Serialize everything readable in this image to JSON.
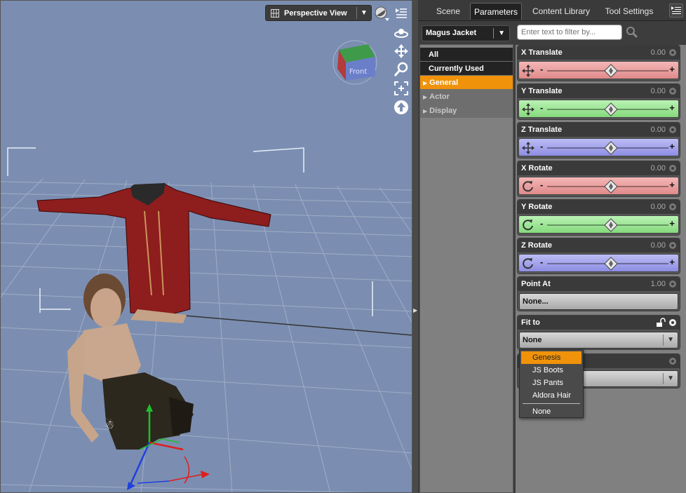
{
  "viewport": {
    "view_label": "Perspective View",
    "cube_face": "Front"
  },
  "tabs": [
    {
      "label": "Scene"
    },
    {
      "label": "Parameters"
    },
    {
      "label": "Content Library"
    },
    {
      "label": "Tool Settings"
    }
  ],
  "node_selector": {
    "value": "Magus Jacket"
  },
  "categories": [
    {
      "label": "All"
    },
    {
      "label": "Currently Used"
    },
    {
      "label": "General"
    },
    {
      "label": "Actor"
    },
    {
      "label": "Display"
    }
  ],
  "filter": {
    "placeholder": "Enter text to filter by..."
  },
  "properties": [
    {
      "label": "X Translate",
      "value": "0.00",
      "color": "red",
      "icon": "move-icon"
    },
    {
      "label": "Y Translate",
      "value": "0.00",
      "color": "green",
      "icon": "move-icon"
    },
    {
      "label": "Z Translate",
      "value": "0.00",
      "color": "blue",
      "icon": "move-icon"
    },
    {
      "label": "X Rotate",
      "value": "0.00",
      "color": "red",
      "icon": "rotate-icon"
    },
    {
      "label": "Y Rotate",
      "value": "0.00",
      "color": "green",
      "icon": "rotate-icon"
    },
    {
      "label": "Z Rotate",
      "value": "0.00",
      "color": "blue",
      "icon": "rotate-icon"
    }
  ],
  "slider_minus": "-",
  "slider_plus": "+",
  "point_at": {
    "label": "Point At",
    "value": "1.00",
    "button": "None..."
  },
  "fit_to": {
    "label": "Fit to",
    "value": "None"
  },
  "popup": {
    "items": [
      {
        "label": "Genesis"
      },
      {
        "label": "JS Boots"
      },
      {
        "label": "JS Pants"
      },
      {
        "label": "Aldora Hair"
      }
    ],
    "footer": "None"
  },
  "colors": {
    "accent": "#f0920a",
    "viewport_bg": "#7b8eb1"
  }
}
